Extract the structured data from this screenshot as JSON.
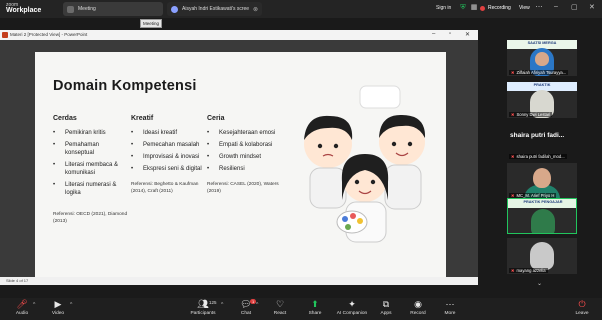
{
  "app": {
    "logo_line1": "zoom",
    "logo_line2": "Workplace"
  },
  "tabs": [
    {
      "label": "Meeting"
    },
    {
      "label": "Aisyah Indri Estikawati's scree",
      "close": "⊗"
    }
  ],
  "tooltip": "Meeting",
  "header": {
    "sign_in": "Sign in",
    "recording": "Recording",
    "view": "View"
  },
  "window": {
    "title": "Materi 2 [Protected View] - PowerPoint",
    "status": "Slide 4 of 17"
  },
  "slide": {
    "title": "Domain Kompetensi",
    "columns": [
      {
        "heading": "Cerdas",
        "items": [
          "Pemikiran kritis",
          "Pemahaman konseptual",
          "Literasi membaca & komunikasi",
          "Literasi numerasi & logika"
        ],
        "reference": "Referensi: OECD (2021), Diamond (2013)"
      },
      {
        "heading": "Kreatif",
        "items": [
          "Ideasi kreatif",
          "Pemecahan masalah",
          "Improvisasi & inovasi",
          "Ekspresi seni & digital"
        ],
        "reference": "Referensi: Beghetto & Kaufman (2014), Craft (2011)"
      },
      {
        "heading": "Ceria",
        "items": [
          "Kesejahteraan emosi",
          "Empati & kolaborasi",
          "Growth mindset",
          "Resiliensi"
        ],
        "reference": "Referensi: CASEL (2020), Waters (2019)"
      }
    ]
  },
  "participants_panel": [
    {
      "name": "Zilfaiah Afiriyah Tsurayya...",
      "banner": "SAATSI MERGA"
    },
    {
      "name": "Sonny Dwi Lestari",
      "banner": "PRAKTIK"
    },
    {
      "name": "shaira putri fadilah_mod...",
      "big_name": "shaira putri fadi..."
    },
    {
      "name": "MC_M. Arief Priyo H",
      "banner": ""
    },
    {
      "name": "",
      "banner": "PRAKTIK PENGAJAR"
    },
    {
      "name": "mayang azzelia",
      "banner": ""
    }
  ],
  "toolbar": [
    {
      "label": "Audio",
      "icon": "mic-muted-icon"
    },
    {
      "label": "Video",
      "icon": "video-icon"
    },
    {
      "label": "Participants",
      "icon": "participants-icon",
      "count": "125"
    },
    {
      "label": "Chat",
      "icon": "chat-icon",
      "badge": "1"
    },
    {
      "label": "React",
      "icon": "heart-icon"
    },
    {
      "label": "Share",
      "icon": "share-icon"
    },
    {
      "label": "AI Companion",
      "icon": "sparkle-icon"
    },
    {
      "label": "Apps",
      "icon": "apps-icon"
    },
    {
      "label": "Record",
      "icon": "record-icon"
    },
    {
      "label": "More",
      "icon": "more-icon"
    },
    {
      "label": "Leave",
      "icon": "leave-icon"
    }
  ],
  "colors": {
    "accent_red": "#e04040",
    "share_green": "#21c55d",
    "toolbar_bg": "#1f1f1f"
  }
}
